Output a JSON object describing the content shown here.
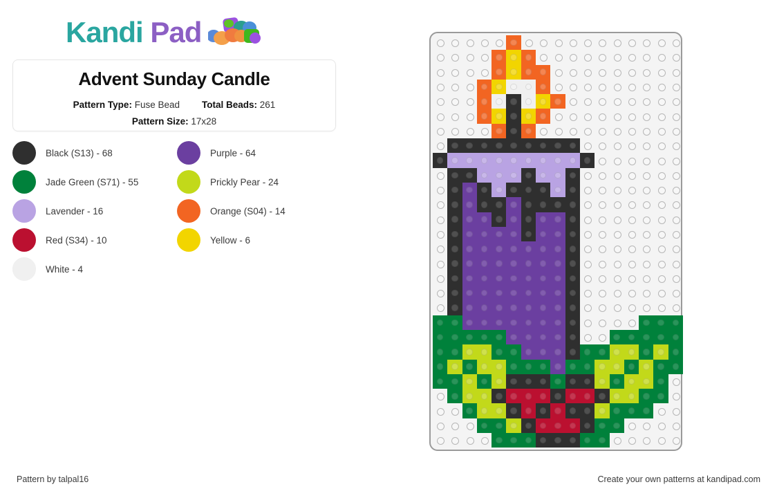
{
  "brand": {
    "name_part1": "Kandi",
    "name_part2": "Pad",
    "icon": "bead-pile-icon",
    "teal": "#2aa6a0",
    "purple": "#8c5fc4"
  },
  "info": {
    "title": "Advent Sunday Candle",
    "pattern_type_label": "Pattern Type:",
    "pattern_type_value": "Fuse Bead",
    "total_beads_label": "Total Beads:",
    "total_beads_value": "261",
    "pattern_size_label": "Pattern Size:",
    "pattern_size_value": "17x28"
  },
  "legend": [
    {
      "key": "K",
      "name": "Black (S13)",
      "count": "68",
      "label": "Black (S13) - 68",
      "color": "#2f2f2f"
    },
    {
      "key": "P",
      "name": "Purple",
      "count": "64",
      "label": "Purple - 64",
      "color": "#6b3fa0"
    },
    {
      "key": "G",
      "name": "Jade Green (S71)",
      "count": "55",
      "label": "Jade Green (S71) - 55",
      "color": "#00813b"
    },
    {
      "key": "Y",
      "name": "Prickly Pear",
      "count": "24",
      "label": "Prickly Pear - 24",
      "color": "#c2d91a"
    },
    {
      "key": "L",
      "name": "Lavender",
      "count": "16",
      "label": "Lavender - 16",
      "color": "#b9a3e3"
    },
    {
      "key": "O",
      "name": "Orange (S04)",
      "count": "14",
      "label": "Orange (S04) - 14",
      "color": "#f26522"
    },
    {
      "key": "R",
      "name": "Red (S34)",
      "count": "10",
      "label": "Red (S34) - 10",
      "color": "#bb1030"
    },
    {
      "key": "E",
      "name": "Yellow",
      "count": "6",
      "label": "Yellow - 6",
      "color": "#f2d500"
    },
    {
      "key": "W",
      "name": "White",
      "count": "4",
      "label": "White - 4",
      "color": "#f0f0f0"
    }
  ],
  "board": {
    "cols": 17,
    "rows": 28,
    "peg_color": "#b6b6b6",
    "board_color": "#f4f4f4",
    "palette": {
      "K": "#2f2f2f",
      "P": "#6b3fa0",
      "G": "#00813b",
      "Y": "#c2d91a",
      "L": "#b9a3e3",
      "O": "#f26522",
      "R": "#bb1030",
      "E": "#f2d500",
      "W": "#f0f0f0",
      ".": null
    },
    "rows_data": [
      ".....O...........",
      "....OEO..........",
      "....OEOO.........",
      "...OEWWO.........",
      "...OWKWEO........",
      "...OEKEO.........",
      "....OKO..........",
      ".KKKKKKKKK.......",
      "KLLLLLLLLLK......",
      ".KKLLLKLLK.......",
      ".KPKLKKKLK.......",
      ".KPKKPKKKK.......",
      ".KPPKPKPPK.......",
      ".KPPPPKPPK.......",
      ".KPPPPPPPK.......",
      ".KPPPPPPPK.......",
      ".KPPPPPPPK.......",
      ".KPPPPPPPK.......",
      ".KPPPPPPPK.......",
      "GGPPPPPPPK....GGG",
      "GGGGGPPPPK..GGGGG",
      "GGYYGGPPPKGGYYGYG",
      "GYGYYGGGPGGYYGYGG",
      "GGYGYKKKGKKYGYYG.",
      ".GYYKRRRKRRKYYGG.",
      "..GYYKRKRKKYGGG..",
      "...GGYKRRRKGG....",
      "....GGGKKKGG....."
    ]
  },
  "footer": {
    "left": "Pattern by talpal16",
    "right": "Create your own patterns at kandipad.com"
  }
}
